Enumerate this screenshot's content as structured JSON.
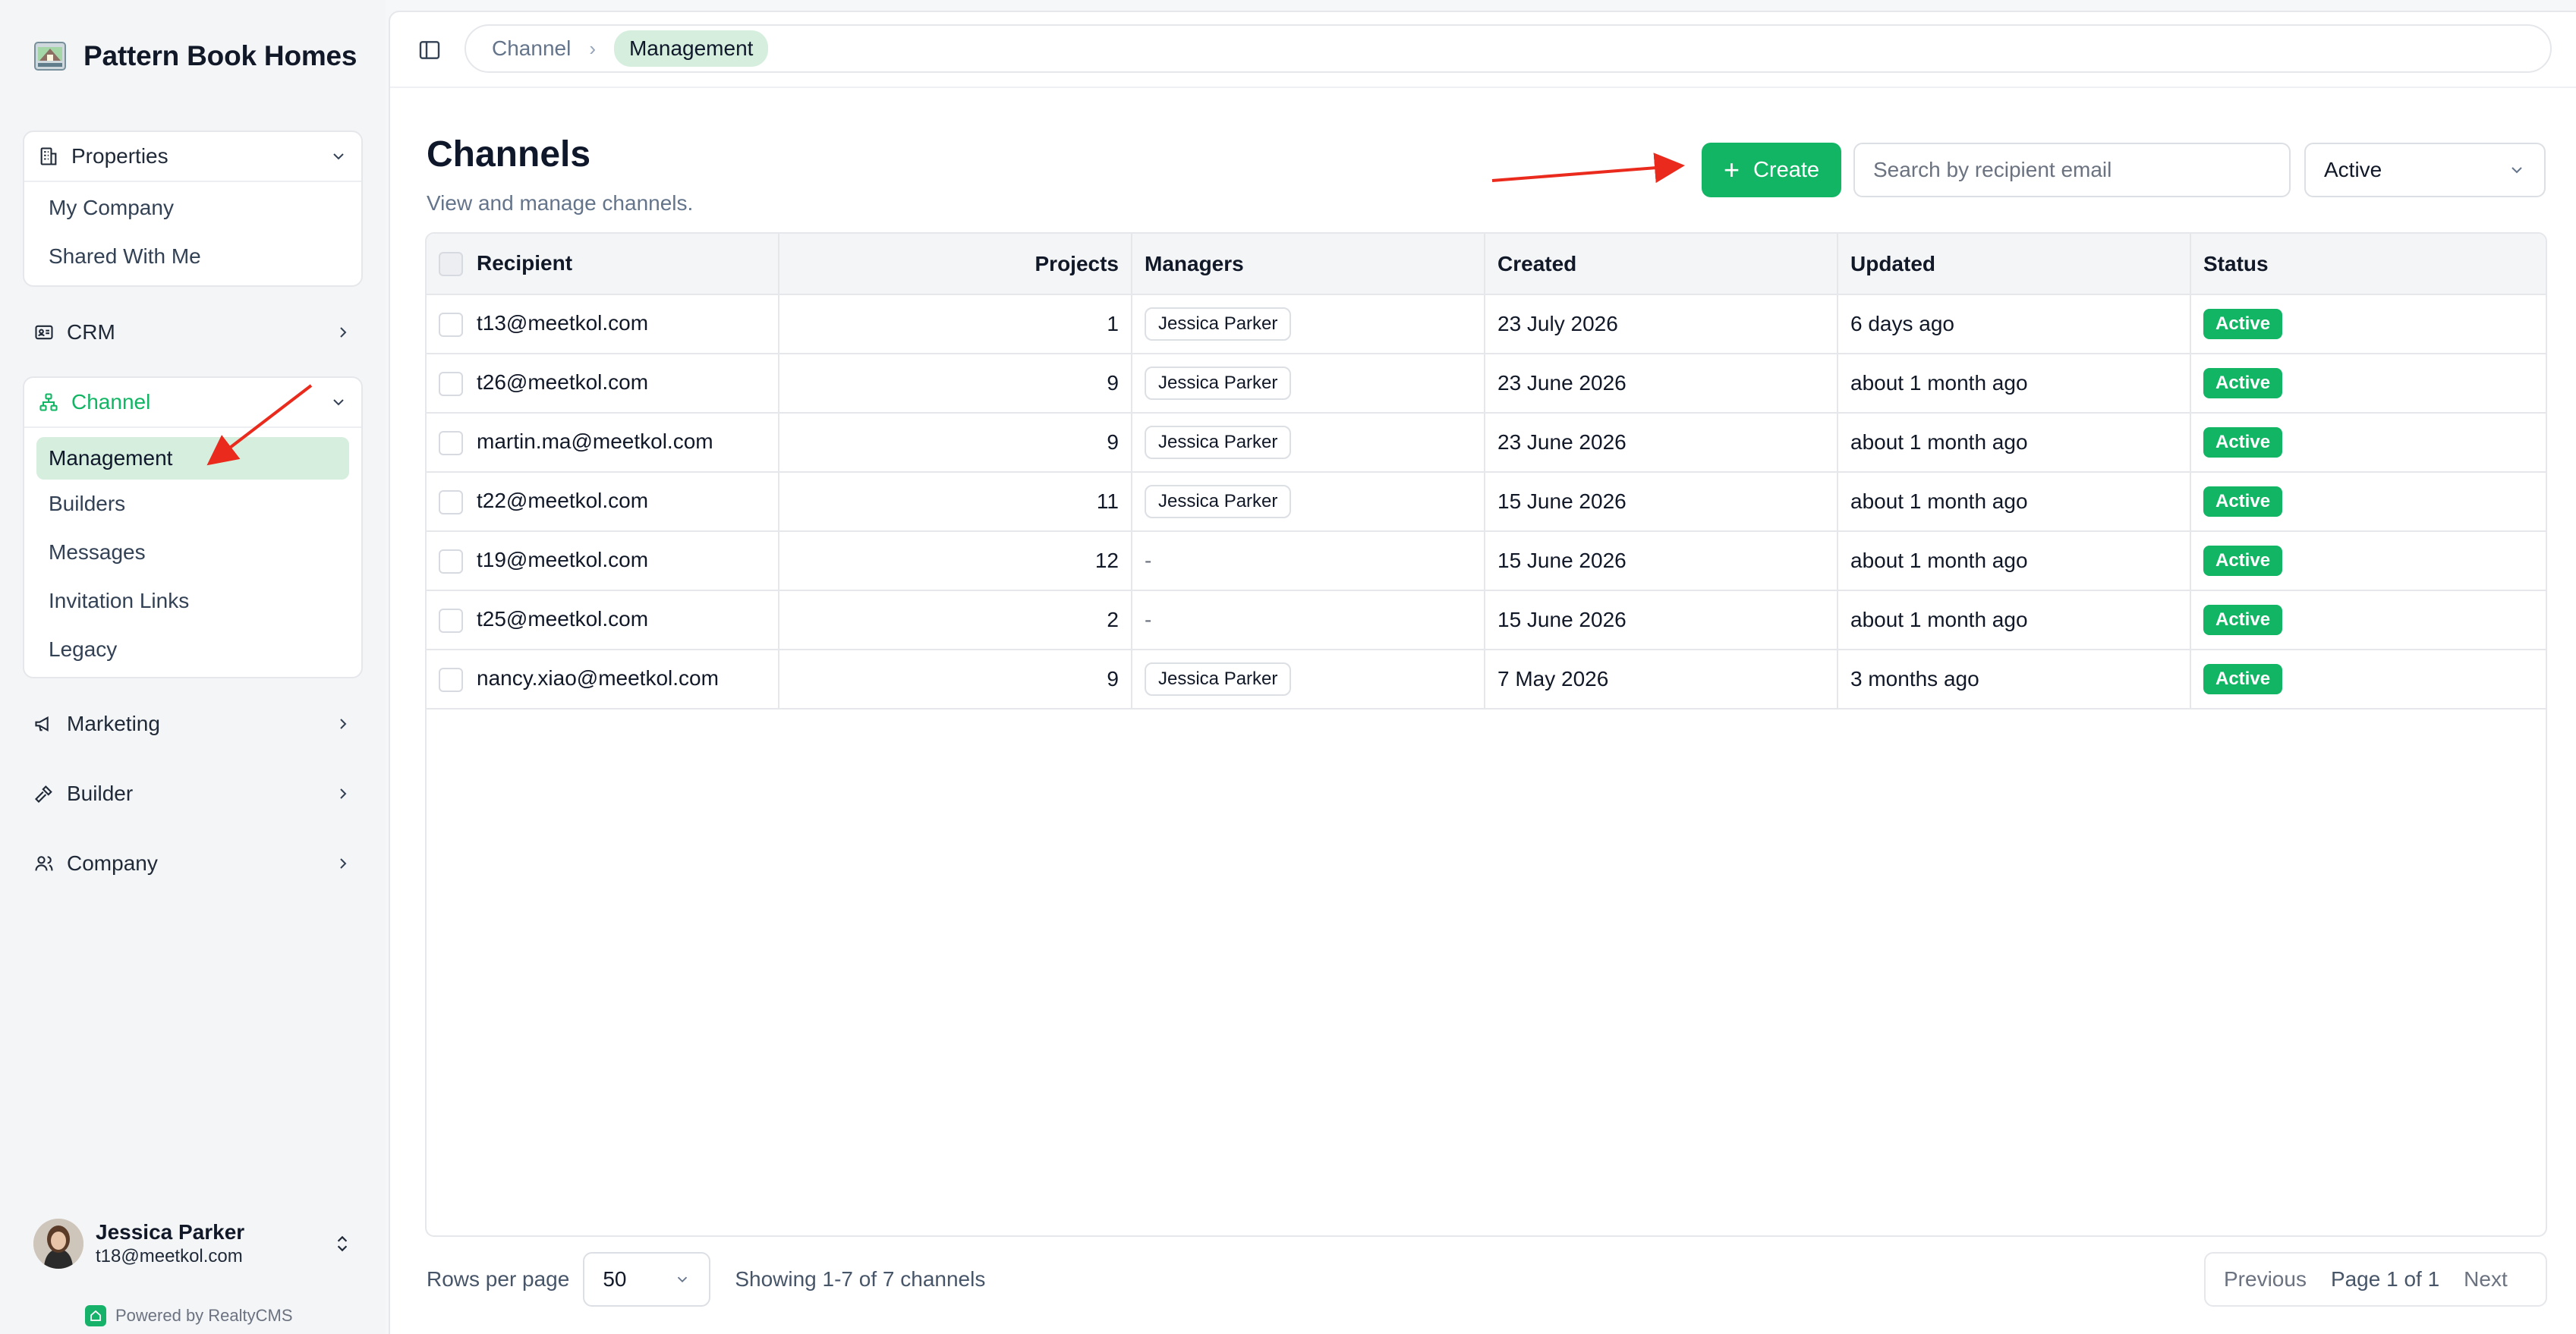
{
  "app": {
    "brand_name": "Pattern Book Homes",
    "powered_by": "Powered by RealtyCMS",
    "accent_color": "#12b564"
  },
  "sidebar": {
    "properties": {
      "label": "Properties",
      "icon": "building-icon",
      "items": [
        "My Company",
        "Shared With Me"
      ]
    },
    "crm": {
      "label": "CRM",
      "icon": "contact-card-icon"
    },
    "channel": {
      "label": "Channel",
      "icon": "network-icon",
      "items": [
        "Management",
        "Builders",
        "Messages",
        "Invitation Links",
        "Legacy"
      ],
      "active_item": "Management"
    },
    "marketing": {
      "label": "Marketing",
      "icon": "megaphone-icon"
    },
    "builder": {
      "label": "Builder",
      "icon": "hammer-icon"
    },
    "company": {
      "label": "Company",
      "icon": "users-icon"
    }
  },
  "user": {
    "name": "Jessica Parker",
    "email": "t18@meetkol.com"
  },
  "breadcrumb": [
    "Channel",
    "Management"
  ],
  "page": {
    "title": "Channels",
    "subtitle": "View and manage channels."
  },
  "toolbar": {
    "create_label": "Create",
    "search_placeholder": "Search by recipient email",
    "status_filter": "Active"
  },
  "table": {
    "columns": [
      "Recipient",
      "Projects",
      "Managers",
      "Created",
      "Updated",
      "Status"
    ],
    "rows": [
      {
        "recipient": "t13@meetkol.com",
        "projects": "1",
        "manager": "Jessica Parker",
        "created": "23 July 2026",
        "updated": "6 days ago",
        "status": "Active"
      },
      {
        "recipient": "t26@meetkol.com",
        "projects": "9",
        "manager": "Jessica Parker",
        "created": "23 June 2026",
        "updated": "about 1 month ago",
        "status": "Active"
      },
      {
        "recipient": "martin.ma@meetkol.com",
        "projects": "9",
        "manager": "Jessica Parker",
        "created": "23 June 2026",
        "updated": "about 1 month ago",
        "status": "Active"
      },
      {
        "recipient": "t22@meetkol.com",
        "projects": "11",
        "manager": "Jessica Parker",
        "created": "15 June 2026",
        "updated": "about 1 month ago",
        "status": "Active"
      },
      {
        "recipient": "t19@meetkol.com",
        "projects": "12",
        "manager": "-",
        "created": "15 June 2026",
        "updated": "about 1 month ago",
        "status": "Active"
      },
      {
        "recipient": "t25@meetkol.com",
        "projects": "2",
        "manager": "-",
        "created": "15 June 2026",
        "updated": "about 1 month ago",
        "status": "Active"
      },
      {
        "recipient": "nancy.xiao@meetkol.com",
        "projects": "9",
        "manager": "Jessica Parker",
        "created": "7 May 2026",
        "updated": "3 months ago",
        "status": "Active"
      }
    ]
  },
  "footer": {
    "rows_per_page_label": "Rows per page",
    "rows_per_page": "50",
    "showing": "Showing 1-7 of 7 channels",
    "previous": "Previous",
    "page_info": "Page 1 of 1",
    "next": "Next"
  }
}
